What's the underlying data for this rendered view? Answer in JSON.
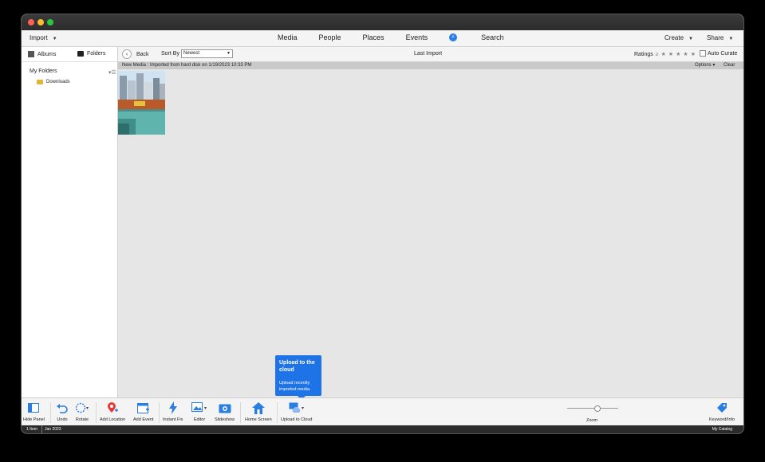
{
  "topbar": {
    "import_label": "Import",
    "nav": [
      "Media",
      "People",
      "Places",
      "Events"
    ],
    "search_label": "Search",
    "create_label": "Create",
    "share_label": "Share"
  },
  "sidebar": {
    "tabs": {
      "albums": "Albums",
      "folders": "Folders"
    },
    "section_title": "My Folders",
    "folders": [
      "Downloads"
    ]
  },
  "toolbar": {
    "back_label": "Back",
    "sort_label": "Sort By",
    "sort_value": "Newest",
    "view_title": "Last Import",
    "ratings_label": "Ratings",
    "auto_curate_label": "Auto Curate"
  },
  "group": {
    "text": "New Media : Imported from hard disk on 1/19/2023 10:33 PM",
    "options_label": "Options",
    "clear_label": "Clear"
  },
  "tooltip": {
    "title": "Upload to the cloud",
    "body": "Upload recently imported media."
  },
  "bottom_tools": {
    "hide_panel": "Hide Panel",
    "undo": "Undo",
    "rotate": "Rotate",
    "add_location": "Add Location",
    "add_event": "Add Event",
    "instant_fix": "Instant Fix",
    "editor": "Editor",
    "slideshow": "Slideshow",
    "home_screen": "Home Screen",
    "upload_to_cloud": "Upload to Cloud",
    "zoom": "Zoom",
    "keyword_info": "Keyword/Info"
  },
  "status": {
    "count": "1 Item",
    "date": "Jan 2023",
    "catalog": "My Catalog"
  },
  "colors": {
    "accent_blue": "#1e73e6",
    "workspace_gray": "#e6e6e6"
  }
}
